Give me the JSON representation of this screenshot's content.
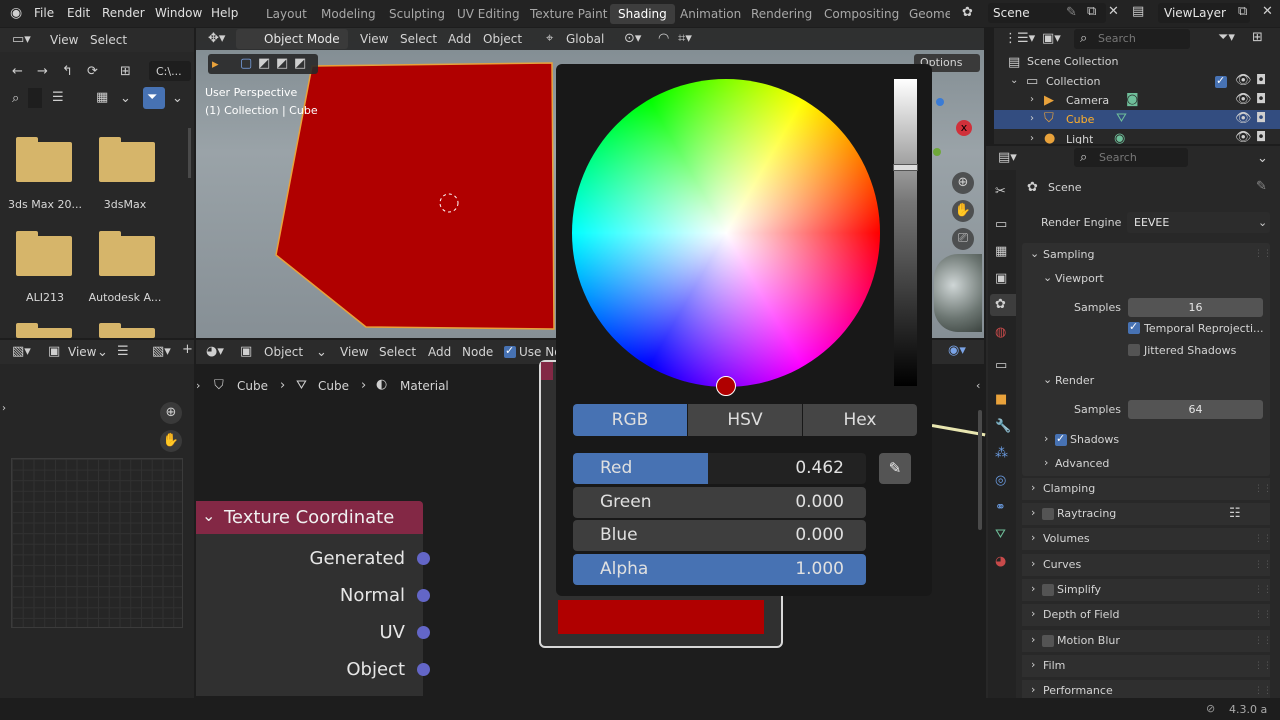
{
  "topbar": {
    "menus": [
      "File",
      "Edit",
      "Render",
      "Window",
      "Help"
    ],
    "workspaces": [
      "Layout",
      "Modeling",
      "Sculpting",
      "UV Editing",
      "Texture Paint",
      "Shading",
      "Animation",
      "Rendering",
      "Compositing",
      "Geome"
    ],
    "active_workspace": "Shading",
    "scene": "Scene",
    "view_layer": "ViewLayer"
  },
  "file_browser": {
    "menus": [
      "View",
      "Select"
    ],
    "path": "C:\\...",
    "search_placeholder": "S",
    "folders": [
      "3ds Max 20...",
      "3dsMax",
      "ALI213",
      "Autodesk A..."
    ]
  },
  "viewport": {
    "mode": "Object Mode",
    "menus": [
      "View",
      "Select",
      "Add",
      "Object"
    ],
    "orientation": "Global",
    "options": "Options",
    "info_line1": "User Perspective",
    "info_line2": "(1) Collection | Cube",
    "cube_color": "#b00000"
  },
  "image_editor": {
    "view": "View"
  },
  "node_editor": {
    "object": "Object",
    "menus": [
      "View",
      "Select",
      "Add",
      "Node"
    ],
    "use_nodes": "Use No",
    "breadcrumb": [
      "Cube",
      "Cube",
      "Material"
    ],
    "node_title": "Texture Coordinate",
    "outputs": [
      "Generated",
      "Normal",
      "UV",
      "Object"
    ]
  },
  "color_picker": {
    "tabs": [
      "RGB",
      "HSV",
      "Hex"
    ],
    "active_tab": "RGB",
    "rows": [
      {
        "name": "Red",
        "value": "0.462"
      },
      {
        "name": "Green",
        "value": "0.000"
      },
      {
        "name": "Blue",
        "value": "0.000"
      },
      {
        "name": "Alpha",
        "value": "1.000"
      }
    ],
    "swatch_color": "#b00000"
  },
  "outliner": {
    "search_placeholder": "Search",
    "scene_collection": "Scene Collection",
    "items": [
      "Collection",
      "Camera",
      "Cube",
      "Light"
    ]
  },
  "properties": {
    "search_placeholder": "Search",
    "context": "Scene",
    "render_engine_label": "Render Engine",
    "render_engine": "EEVEE",
    "sampling": "Sampling",
    "viewport": "Viewport",
    "samples_label": "Samples",
    "viewport_samples": "16",
    "temporal": "Temporal Reprojecti...",
    "jittered": "Jittered Shadows",
    "render": "Render",
    "render_samples": "64",
    "shadows": "Shadows",
    "advanced": "Advanced",
    "panels": [
      "Clamping",
      "Raytracing",
      "Volumes",
      "Curves",
      "Simplify",
      "Depth of Field",
      "Motion Blur",
      "Film",
      "Performance"
    ]
  },
  "status": {
    "version": "4.3.0 a"
  }
}
